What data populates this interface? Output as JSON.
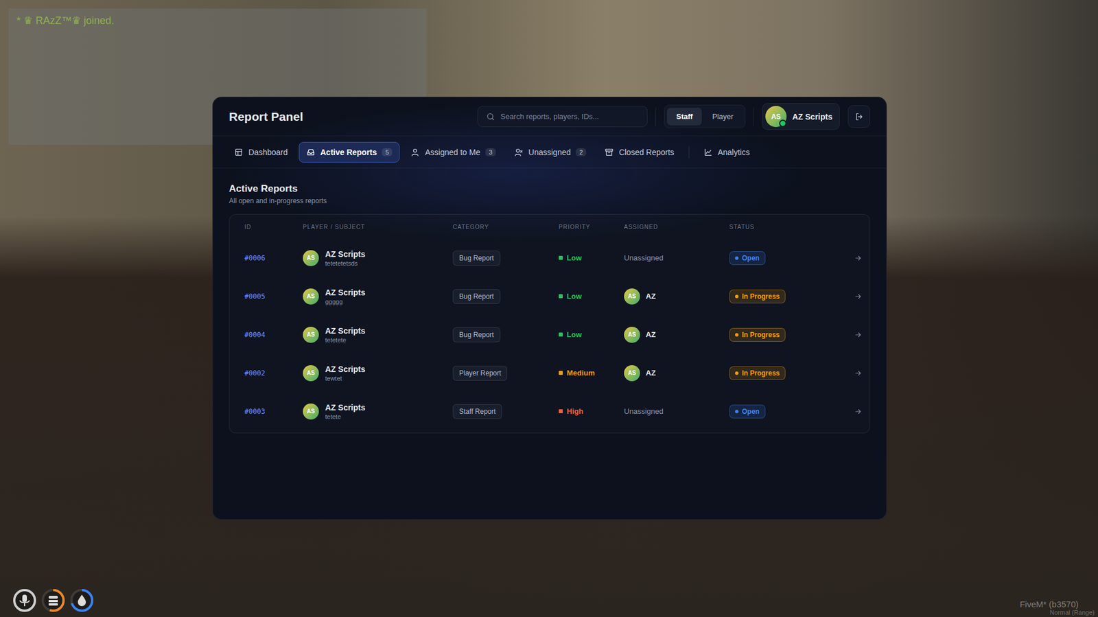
{
  "scene": {
    "chat": [
      "* ♛ RAzZ™♛ joined."
    ],
    "build": "FiveM* (b3570)",
    "voice_mode": "Normal (Range)",
    "hud": [
      {
        "kind": "mic",
        "level": 1,
        "color": "#cfcfcf"
      },
      {
        "kind": "armor",
        "level": 0.55,
        "color": "#e8892b"
      },
      {
        "kind": "water",
        "level": 0.7,
        "color": "#3b82f6"
      }
    ]
  },
  "panel": {
    "title": "Report Panel",
    "search": {
      "placeholder": "Search reports, players, IDs..."
    },
    "mode": [
      {
        "label": "Staff",
        "selected": true
      },
      {
        "label": "Player",
        "selected": false
      }
    ],
    "user": {
      "initials": "AS",
      "name": "AZ Scripts",
      "online": true
    },
    "tabs": [
      {
        "label": "Dashboard",
        "count": "",
        "kind": "dashboard",
        "group": 1,
        "selected": false
      },
      {
        "label": "Active Reports",
        "count": "5",
        "kind": "inbox",
        "group": 1,
        "selected": true
      },
      {
        "label": "Assigned to Me",
        "count": "3",
        "kind": "user",
        "group": 1,
        "selected": false
      },
      {
        "label": "Unassigned",
        "count": "2",
        "kind": "userx",
        "group": 1,
        "selected": false
      },
      {
        "label": "Closed Reports",
        "count": "",
        "kind": "archive",
        "group": 1,
        "selected": false
      },
      {
        "label": "Analytics",
        "count": "",
        "kind": "chart",
        "group": 2,
        "selected": false
      }
    ],
    "section": {
      "title": "Active Reports",
      "subtitle": "All open and in-progress reports"
    },
    "table": {
      "columns": [
        "ID",
        "PLAYER / SUBJECT",
        "CATEGORY",
        "PRIORITY",
        "ASSIGNED",
        "STATUS"
      ],
      "rows": [
        {
          "id": "#0006",
          "initials": "AS",
          "player": "AZ Scripts",
          "subject": "tetetetetsds",
          "category": "Bug Report",
          "priority": "Low",
          "priority_color": "#22c55e",
          "assigned": {
            "kind": "none",
            "label": "Unassigned"
          },
          "status": "Open",
          "status_color": "#3b82f6"
        },
        {
          "id": "#0005",
          "initials": "AS",
          "player": "AZ Scripts",
          "subject": "ggggg",
          "category": "Bug Report",
          "priority": "Low",
          "priority_color": "#22c55e",
          "assigned": {
            "kind": "user",
            "initials": "AS",
            "label": "AZ"
          },
          "status": "In Progress",
          "status_color": "#f59e0b"
        },
        {
          "id": "#0004",
          "initials": "AS",
          "player": "AZ Scripts",
          "subject": "tetetete",
          "category": "Bug Report",
          "priority": "Low",
          "priority_color": "#22c55e",
          "assigned": {
            "kind": "user",
            "initials": "AS",
            "label": "AZ"
          },
          "status": "In Progress",
          "status_color": "#f59e0b"
        },
        {
          "id": "#0002",
          "initials": "AS",
          "player": "AZ Scripts",
          "subject": "tewtet",
          "category": "Player Report",
          "priority": "Medium",
          "priority_color": "#f59e0b",
          "assigned": {
            "kind": "user",
            "initials": "AS",
            "label": "AZ"
          },
          "status": "In Progress",
          "status_color": "#f59e0b"
        },
        {
          "id": "#0003",
          "initials": "AS",
          "player": "AZ Scripts",
          "subject": "tetete",
          "category": "Staff Report",
          "priority": "High",
          "priority_color": "#f0603a",
          "assigned": {
            "kind": "none",
            "label": "Unassigned"
          },
          "status": "Open",
          "status_color": "#3b82f6"
        }
      ]
    }
  }
}
